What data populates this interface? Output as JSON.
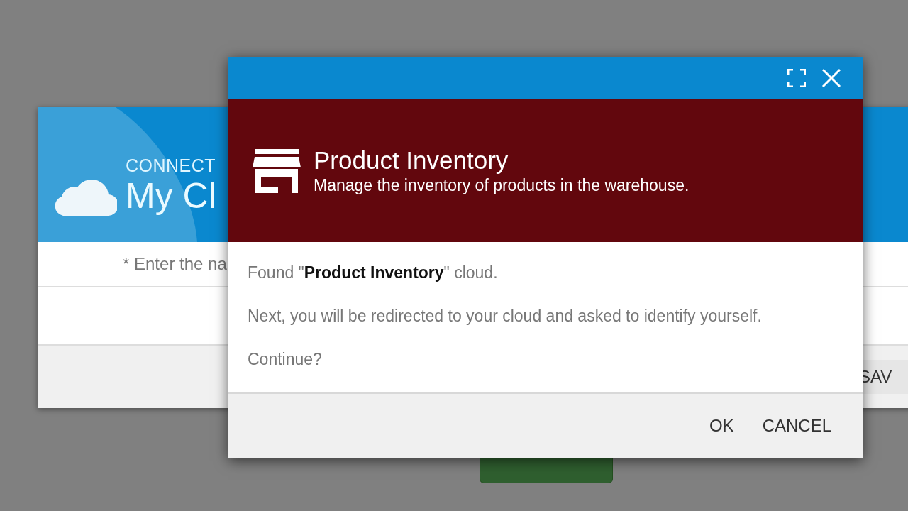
{
  "background_window": {
    "header_label": "CONNECT",
    "title": "My Cl",
    "field_hint": "* Enter the na",
    "footer_button": "SAV"
  },
  "dialog": {
    "app_name": "Product Inventory",
    "app_description": "Manage the inventory of products in the warehouse.",
    "messages": [
      "Found \"**Product Inventory**\" cloud.",
      "Next, you will be redirected to your cloud and asked to identify yourself.",
      "Continue?"
    ],
    "buttons": [
      "OK",
      "CANCEL"
    ]
  }
}
